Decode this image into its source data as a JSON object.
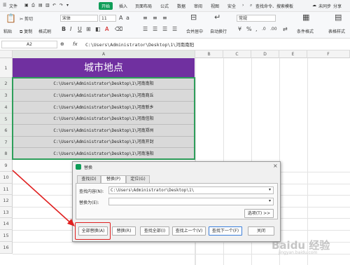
{
  "menu": {
    "file": "文件",
    "items": [
      "开始",
      "插入",
      "页面布局",
      "公式",
      "数据",
      "审阅",
      "视图",
      "安全"
    ],
    "search": "查找命令、搜索模板",
    "unsync": "未同步",
    "share": "分享"
  },
  "ribbon": {
    "paste": "粘贴",
    "cut": "剪切",
    "copy": "复制",
    "format_painter": "格式刷",
    "font_name": "宋体",
    "font_size": "11",
    "number_format": "常规",
    "merge_center": "合并居中",
    "wrap": "自动换行",
    "conditional_format": "条件格式",
    "table_style": "表格样式"
  },
  "formula_bar": {
    "cell_ref": "A2",
    "fx": "fx",
    "content": "C:\\Users\\Administrator\\Desktop\\1\\河南南阳"
  },
  "columns": [
    "A",
    "B",
    "C",
    "D",
    "E",
    "F"
  ],
  "rows": [
    "1",
    "2",
    "3",
    "4",
    "5",
    "6",
    "7",
    "8",
    "9",
    "10",
    "11",
    "12",
    "13",
    "14",
    "15",
    "16"
  ],
  "sheet": {
    "title": "城市地点",
    "cells": [
      "C:\\Users\\Administrator\\Desktop\\1\\河南南阳",
      "C:\\Users\\Administrator\\Desktop\\1\\河南商丘",
      "C:\\Users\\Administrator\\Desktop\\1\\河南新乡",
      "C:\\Users\\Administrator\\Desktop\\1\\河南信阳",
      "C:\\Users\\Administrator\\Desktop\\1\\河南郑州",
      "C:\\Users\\Administrator\\Desktop\\1\\河南开封",
      "C:\\Users\\Administrator\\Desktop\\1\\河南洛阳"
    ]
  },
  "dialog": {
    "title": "替换",
    "tabs": [
      "查找(D)",
      "替换(P)",
      "定位(G)"
    ],
    "find_label": "查找内容(N):",
    "find_value": "C:\\Users\\Administrator\\Desktop\\1\\",
    "replace_label": "替换为(E):",
    "replace_value": "",
    "options": "选项(T) >>",
    "buttons": {
      "replace_all": "全部替换(A)",
      "replace": "替换(R)",
      "find_all": "查找全部(I)",
      "find_prev": "查找上一个(V)",
      "find_next": "查找下一个(F)",
      "close": "关闭"
    }
  },
  "watermark": "Baidu 经验",
  "watermark_sub": "jingyan.baidu.com",
  "colors": {
    "title_fill": "#7030a0",
    "data_fill": "#d9d9d9",
    "accent_green": "#0f9d58",
    "annotation_red": "#e02020"
  }
}
